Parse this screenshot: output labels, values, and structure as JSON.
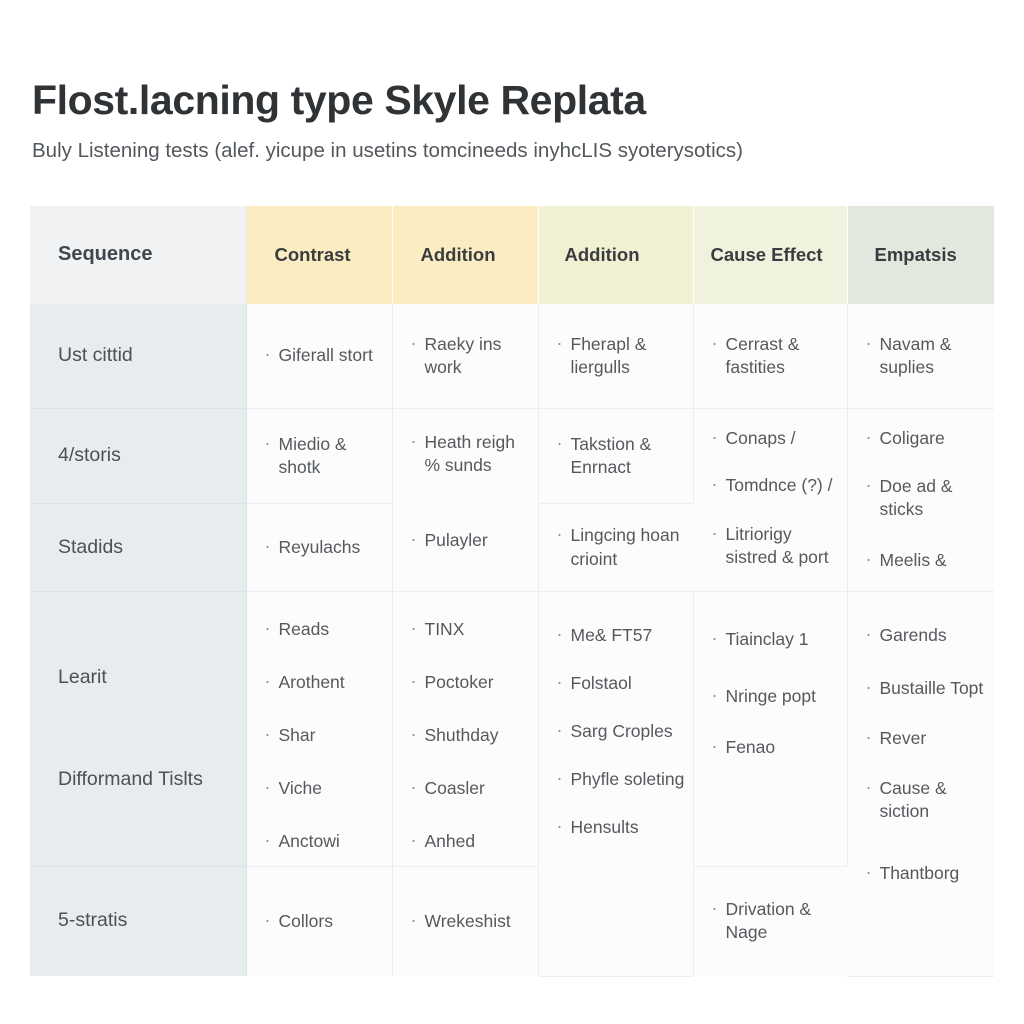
{
  "header": {
    "title": "Flost.lacning type Skyle Replata",
    "subtitle": "Buly Listening tests (alef. yicupe in usetins tomcineeds inyhcLIS syoterysotics)"
  },
  "colors": {
    "header_col0": "#f0f2f4",
    "header_col1": "#fcecc2",
    "header_col2": "#fcecc2",
    "header_col3": "#f1f0d2",
    "header_col4": "#f0f2dd",
    "header_col5": "#e1e9df",
    "seq_cell": "#e7ecef",
    "body_cell": "#fcfcfc",
    "text": "#55595d",
    "title_text": "#2f3336"
  },
  "table": {
    "columns": [
      "Sequence",
      "Contrast",
      "Addition",
      "Addition",
      "Cause Effect",
      "Empatsis"
    ],
    "rows": [
      {
        "label": "Ust cittid",
        "label_lines": [
          "Ust cittid"
        ],
        "cells": [
          [
            "Giferall stort"
          ],
          [
            "Raeky ins work"
          ],
          [
            "Fherapl & liergulls"
          ],
          [
            "Cerrast & fastities"
          ],
          [
            "Navam & suplies"
          ]
        ]
      },
      {
        "label": "4/storis",
        "label_lines": [
          "4/storis"
        ],
        "cells": [
          [
            "Miedio & shotk"
          ],
          [
            "Heath reigh % sunds"
          ],
          [
            "Takstion & Enrnact"
          ],
          [
            "Conaps /",
            "Tomdnce (?) /"
          ],
          [
            "Coligare",
            "Doe ad & sticks"
          ]
        ]
      },
      {
        "label": "Stadids",
        "label_lines": [
          "Stadids"
        ],
        "cells": [
          [
            "Reyulachs"
          ],
          [
            "Pulayler"
          ],
          [
            "Lingcing hoan crioint"
          ],
          [
            "Litriorigy sistred & port"
          ],
          [
            "Meelis &"
          ]
        ]
      },
      {
        "label": "Learit / Difformand Tislts",
        "label_lines": [
          "Learit",
          "Difformand Tislts"
        ],
        "cells": [
          [
            "Reads",
            "Arothent",
            "Shar",
            "Viche",
            "Anctowi"
          ],
          [
            "TINX",
            "Poctoker",
            "Shuthday",
            "Coasler",
            "Anhed"
          ],
          [
            "Me& FT57",
            "Folstaol",
            "Sarg Croples",
            "Phyfle soleting"
          ],
          [
            "Tiainclay 1",
            "Nringe popt",
            "Fenao"
          ],
          [
            "Garends",
            "Bustaille Topt",
            "Rever",
            "Cause & siction"
          ]
        ]
      },
      {
        "label": "5-stratis",
        "label_lines": [
          "5-stratis"
        ],
        "cells": [
          [
            "Collors"
          ],
          [
            "Wrekeshist"
          ],
          [
            "Hensults"
          ],
          [
            "Drivation & Nage"
          ],
          [
            "Thantborg"
          ]
        ]
      }
    ]
  }
}
